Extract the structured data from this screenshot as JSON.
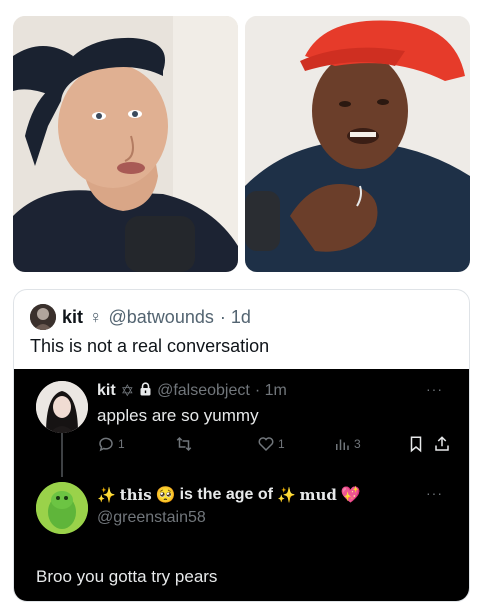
{
  "photos": {
    "left": {
      "description_icon": "man-in-backwards-cap-photo"
    },
    "right": {
      "description_icon": "man-in-red-cap-photo"
    }
  },
  "quote_tweet": {
    "name": "kit",
    "name_badge": "♀",
    "handle": "@batwounds",
    "time": "· 1d",
    "text": "This is not a real conversation"
  },
  "embedded_thread": {
    "tweet1": {
      "name": "kit",
      "badge": "✡",
      "lock": "lock-icon",
      "handle": "@falseobject",
      "time": "· 1m",
      "text": "apples are so yummy",
      "more": "···",
      "actions": {
        "replies": "1",
        "reposts": "",
        "likes": "1",
        "views": "3"
      }
    },
    "tweet2": {
      "name_parts": {
        "sparkle1": "✨",
        "this": "this",
        "pleading": "🥺",
        "mid": "is the age of",
        "sparkle2": "✨",
        "mud": "mud",
        "heart": "💖"
      },
      "handle": "@greenstain58",
      "more": "···",
      "text": "Broo you gotta try pears"
    }
  },
  "colors": {
    "dark_bg": "#000000",
    "muted": "#71767b",
    "text_dark": "#e7e9ea",
    "border": "#dfe3e7"
  }
}
